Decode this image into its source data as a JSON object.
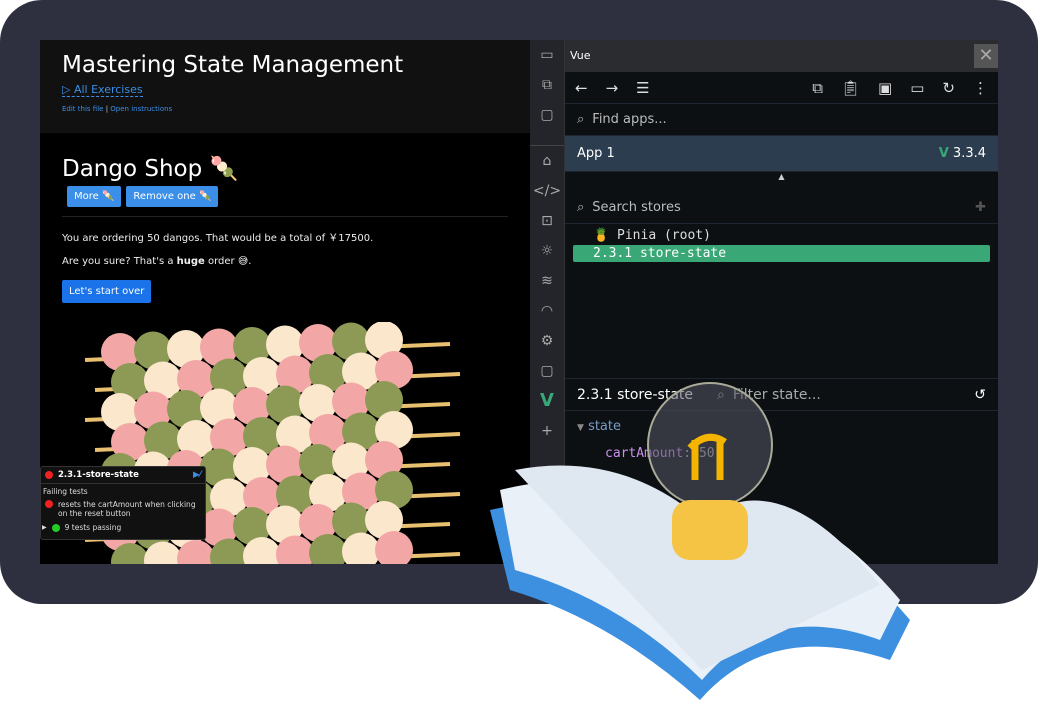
{
  "app": {
    "title": "Mastering State Management",
    "all_exercises": "▷  All Exercises",
    "edit_link": "Edit this file",
    "separator": "|",
    "instructions_link": "Open instructions",
    "shop_title": "Dango Shop 🍡",
    "more_btn": "More 🍡",
    "remove_btn": "Remove one 🍡",
    "order_text": "You are ordering 50 dangos. That would be a total of ￥17500.",
    "confirm_pre": "Are you sure? That's a ",
    "confirm_bold": "huge",
    "confirm_post": " order 😅.",
    "start_over": "Let's start over"
  },
  "tests": {
    "name": "2.3.1-store-state",
    "failing_label": "Failing tests",
    "failing": [
      "resets the cartAmount when clicking on the reset button"
    ],
    "passing": "9 tests passing"
  },
  "devtools": {
    "title": "Vue",
    "close": "✕",
    "find_apps": "Find apps...",
    "app_name": "App 1",
    "vue_version": "3.3.4",
    "search_stores": "Search stores",
    "stores": [
      "🍍 Pinia (root)",
      "2.3.1 store-state"
    ],
    "selected_store": "2.3.1 store-state",
    "filter_state": "Filter state...",
    "state_label": "state",
    "state_key": "cartAmount",
    "state_value": "50"
  },
  "colors": {
    "accent": "#3aa876",
    "button": "#3b8fe8",
    "frame": "#2e303f"
  }
}
